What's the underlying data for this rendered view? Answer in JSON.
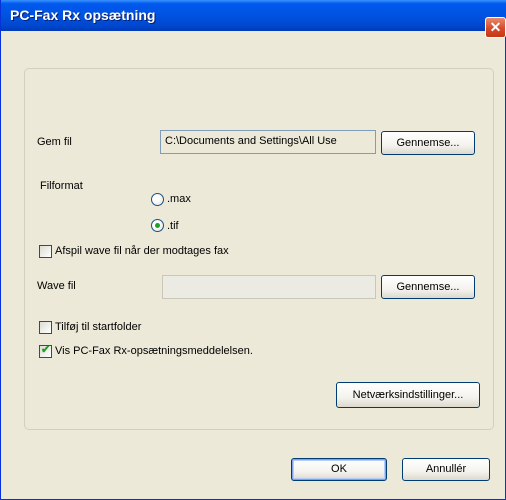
{
  "dialog": {
    "title": "PC-Fax Rx opsætning",
    "close_glyph": "✕"
  },
  "save_file": {
    "label": "Gem fil",
    "path_value": "C:\\Documents and Settings\\All Use",
    "browse_label": "Gennemse..."
  },
  "file_format": {
    "label": "Filformat",
    "options": [
      {
        "label": ".max",
        "selected": false
      },
      {
        "label": ".tif",
        "selected": true
      }
    ]
  },
  "wave": {
    "play_label": "Afspil wave fil når der modtages fax",
    "play_checked": false,
    "file_label": "Wave fil",
    "file_value": "",
    "browse_label": "Gennemse..."
  },
  "startup": {
    "label": "Tilføj til startfolder",
    "checked": false
  },
  "show_message": {
    "label": "Vis PC-Fax Rx-opsætningsmeddelelsen.",
    "checked": true
  },
  "network_button_label": "Netværksindstillinger...",
  "footer": {
    "ok_label": "OK",
    "cancel_label": "Annullér"
  },
  "colors": {
    "titlebar": "#0054e3",
    "window_face": "#ece9d8",
    "close_button": "#d8492a",
    "check_green": "#21a121"
  }
}
